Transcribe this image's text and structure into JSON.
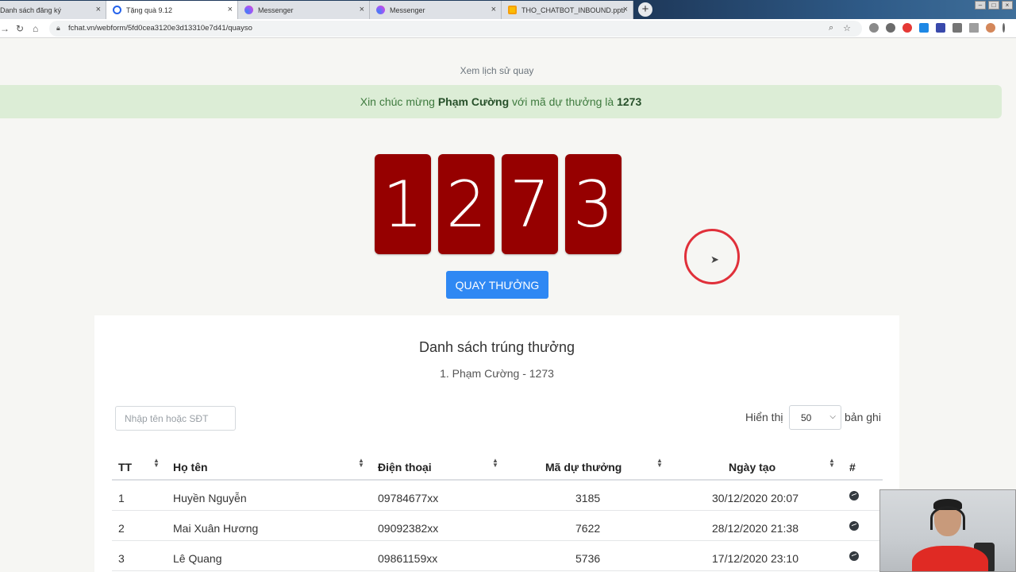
{
  "browser": {
    "tabs": [
      {
        "title": "Danh sách đăng ký",
        "icon": "globe-icon",
        "active": false
      },
      {
        "title": "Tặng quà 9.12",
        "icon": "globe-icon",
        "active": true
      },
      {
        "title": "Messenger",
        "icon": "messenger-icon",
        "active": false
      },
      {
        "title": "Messenger",
        "icon": "messenger-icon",
        "active": false
      },
      {
        "title": "THO_CHATBOT_INBOUND.pptx",
        "icon": "slides-icon",
        "active": false
      }
    ],
    "url": "fchat.vn/webform/5fd0cea3120e3d13310e7d41/quayso"
  },
  "page": {
    "history_link": "Xem lịch sử quay",
    "alert": {
      "prefix": "Xin chúc mừng ",
      "winner": "Phạm Cường",
      "middle": " với mã dự thưởng là ",
      "code": "1273"
    },
    "digits": [
      "1",
      "2",
      "7",
      "3"
    ],
    "spin_button": "QUAY THƯỞNG",
    "winners_title": "Danh sách trúng thưởng",
    "winners_list": "1. Phạm Cường - 1273",
    "search_placeholder": "Nhập tên hoặc SĐT",
    "show_label": "Hiển thị",
    "page_size": "50",
    "records_label": "bản ghi",
    "table": {
      "headers": [
        "TT",
        "Họ tên",
        "Điện thoại",
        "Mã dự thưởng",
        "Ngày tạo",
        "#"
      ],
      "rows": [
        [
          "1",
          "Huyền Nguyễn",
          "09784677xx",
          "3185",
          "30/12/2020 20:07"
        ],
        [
          "2",
          "Mai Xuân Hương",
          "09092382xx",
          "7622",
          "28/12/2020 21:38"
        ],
        [
          "3",
          "Lê Quang",
          "09861159xx",
          "5736",
          "17/12/2020 23:10"
        ]
      ]
    }
  },
  "colors": {
    "digit_bg": "#960000",
    "button_bg": "#2f88f3",
    "alert_bg": "#dcedd6",
    "cursor_ring": "#e0303a"
  }
}
